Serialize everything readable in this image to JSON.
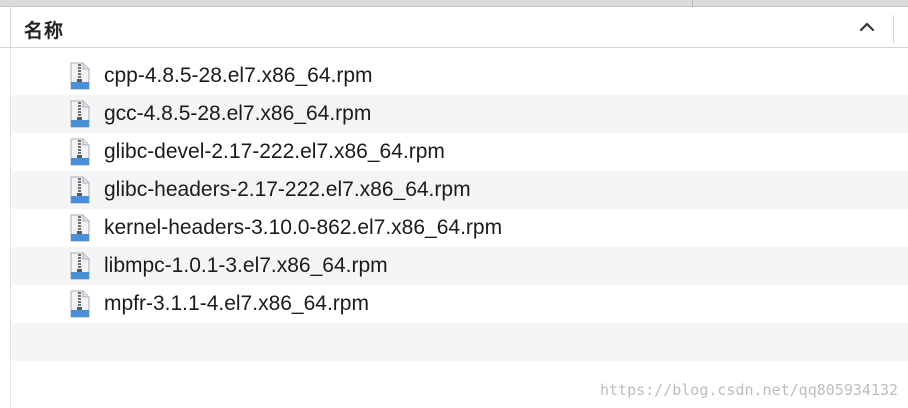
{
  "header": {
    "column_name": "名称",
    "sort_icon": "chevron-up-icon"
  },
  "files": [
    {
      "name": "cpp-4.8.5-28.el7.x86_64.rpm",
      "icon": "archive-file-icon"
    },
    {
      "name": "gcc-4.8.5-28.el7.x86_64.rpm",
      "icon": "archive-file-icon"
    },
    {
      "name": "glibc-devel-2.17-222.el7.x86_64.rpm",
      "icon": "archive-file-icon"
    },
    {
      "name": "glibc-headers-2.17-222.el7.x86_64.rpm",
      "icon": "archive-file-icon"
    },
    {
      "name": "kernel-headers-3.10.0-862.el7.x86_64.rpm",
      "icon": "archive-file-icon"
    },
    {
      "name": "libmpc-1.0.1-3.el7.x86_64.rpm",
      "icon": "archive-file-icon"
    },
    {
      "name": "mpfr-3.1.1-4.el7.x86_64.rpm",
      "icon": "archive-file-icon"
    }
  ],
  "watermark": "https://blog.csdn.net/qq805934132",
  "colors": {
    "row_alt": "#f5f5f5",
    "icon_blue": "#4a90d9",
    "icon_gray": "#9aa0a6"
  }
}
